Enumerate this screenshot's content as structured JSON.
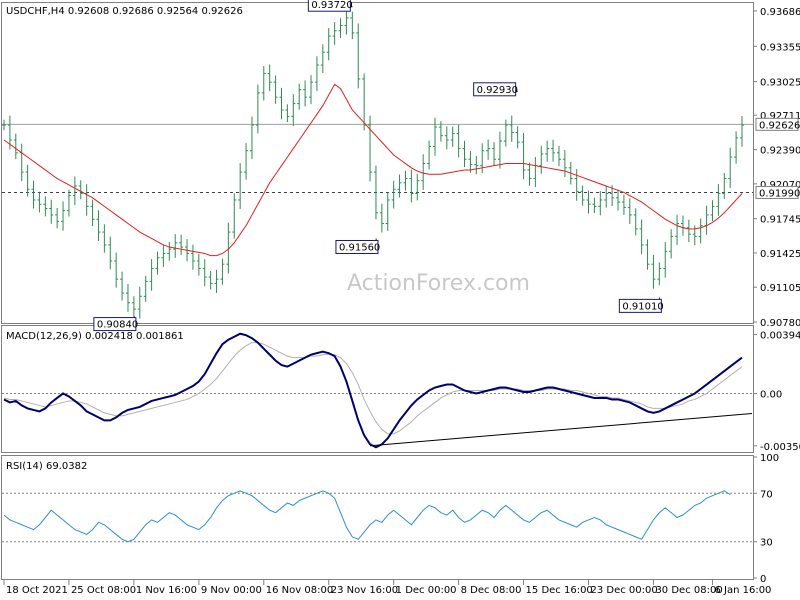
{
  "colors": {
    "price_bars": "#2e8b57",
    "ma_line": "#e02020",
    "macd_main": "#00006e",
    "macd_signal": "#b0b0b0",
    "rsi_line": "#2a8fd6",
    "grid": "#808080",
    "label_border": "#1a1a6e"
  },
  "chart_data": [
    {
      "type": "line",
      "panel": "price",
      "title": "USDCHF,H4 0.92608 0.92686 0.92564 0.92626",
      "y_ticks": [
        "0.93686",
        "0.93355",
        "0.93025",
        "0.92711",
        "0.92390",
        "0.92070",
        "0.91745",
        "0.91425",
        "0.91105",
        "0.90780"
      ],
      "y_tick_values": [
        0.93686,
        0.93355,
        0.93025,
        0.92711,
        0.9239,
        0.9207,
        0.91745,
        0.91425,
        0.91105,
        0.9078
      ],
      "ylim": [
        0.9078,
        0.9375
      ],
      "current_price_label": "0.92626",
      "current_price": 0.92626,
      "support_label": "0.91990",
      "support_level": 0.9199,
      "annotations": [
        {
          "text": "0.93720",
          "value": 0.9372,
          "bar": 59
        },
        {
          "text": "0.92930",
          "value": 0.9293,
          "bar": 87
        },
        {
          "text": "0.91560",
          "value": 0.9156,
          "bar": 63
        },
        {
          "text": "0.90840",
          "value": 0.9084,
          "bar": 22
        },
        {
          "text": "0.91010",
          "value": 0.9101,
          "bar": 111
        }
      ],
      "close": [
        0.9262,
        0.9248,
        0.9236,
        0.9218,
        0.9202,
        0.9192,
        0.9188,
        0.9184,
        0.9178,
        0.9172,
        0.9182,
        0.9196,
        0.9205,
        0.9198,
        0.9186,
        0.9174,
        0.9162,
        0.915,
        0.9135,
        0.9118,
        0.9105,
        0.9096,
        0.909,
        0.9102,
        0.9116,
        0.9128,
        0.9138,
        0.9142,
        0.9146,
        0.9152,
        0.9148,
        0.9142,
        0.9135,
        0.9128,
        0.912,
        0.9114,
        0.9118,
        0.9132,
        0.9162,
        0.9192,
        0.9218,
        0.9238,
        0.9262,
        0.9292,
        0.931,
        0.9302,
        0.9288,
        0.9276,
        0.927,
        0.9282,
        0.9295,
        0.9288,
        0.9302,
        0.9318,
        0.933,
        0.9345,
        0.935,
        0.9355,
        0.9362,
        0.9348,
        0.9305,
        0.9262,
        0.9218,
        0.918,
        0.917,
        0.9192,
        0.9202,
        0.9208,
        0.9212,
        0.9198,
        0.921,
        0.9226,
        0.9242,
        0.926,
        0.9252,
        0.9248,
        0.9254,
        0.924,
        0.923,
        0.9225,
        0.9224,
        0.9238,
        0.924,
        0.923,
        0.9247,
        0.9262,
        0.9255,
        0.9246,
        0.922,
        0.9212,
        0.9224,
        0.9235,
        0.924,
        0.9236,
        0.923,
        0.9222,
        0.9212,
        0.92,
        0.9192,
        0.9188,
        0.9186,
        0.9192,
        0.9198,
        0.9194,
        0.919,
        0.9185,
        0.9178,
        0.9165,
        0.915,
        0.9132,
        0.9118,
        0.9128,
        0.9144,
        0.9158,
        0.917,
        0.9166,
        0.916,
        0.9158,
        0.9168,
        0.9178,
        0.9186,
        0.9198,
        0.9212,
        0.9232,
        0.925,
        0.9262
      ],
      "ma": [
        0.9248,
        0.9244,
        0.924,
        0.9236,
        0.9232,
        0.9228,
        0.9224,
        0.922,
        0.9216,
        0.9212,
        0.9209,
        0.9206,
        0.9203,
        0.92,
        0.9197,
        0.9194,
        0.919,
        0.9186,
        0.9182,
        0.9178,
        0.9174,
        0.917,
        0.9166,
        0.9162,
        0.9159,
        0.9156,
        0.9153,
        0.915,
        0.9148,
        0.9147,
        0.9146,
        0.9145,
        0.9144,
        0.9143,
        0.9142,
        0.914,
        0.914,
        0.9142,
        0.9146,
        0.9152,
        0.916,
        0.9168,
        0.9178,
        0.9188,
        0.9198,
        0.9208,
        0.9216,
        0.9224,
        0.9232,
        0.924,
        0.9248,
        0.9256,
        0.9264,
        0.9272,
        0.928,
        0.929,
        0.93,
        0.9296,
        0.9286,
        0.9276,
        0.927,
        0.9264,
        0.9258,
        0.9252,
        0.9246,
        0.924,
        0.9234,
        0.923,
        0.9226,
        0.9222,
        0.9219,
        0.9217,
        0.9216,
        0.9216,
        0.9216,
        0.9217,
        0.9218,
        0.9219,
        0.922,
        0.922,
        0.9221,
        0.9222,
        0.9223,
        0.9224,
        0.9225,
        0.9226,
        0.9226,
        0.9226,
        0.9226,
        0.9225,
        0.9224,
        0.9223,
        0.9222,
        0.9221,
        0.922,
        0.9219,
        0.9217,
        0.9215,
        0.9213,
        0.9211,
        0.9209,
        0.9207,
        0.9205,
        0.9203,
        0.9201,
        0.9199,
        0.9196,
        0.9193,
        0.919,
        0.9186,
        0.9182,
        0.9178,
        0.9174,
        0.9171,
        0.9168,
        0.9166,
        0.9165,
        0.9165,
        0.9166,
        0.9168,
        0.9171,
        0.9175,
        0.918,
        0.9186,
        0.9192,
        0.9198
      ]
    },
    {
      "type": "line",
      "panel": "macd",
      "title": "MACD(12,26,9) 0.002418 0.001861",
      "y_ticks": [
        "0.003944",
        "0.00",
        "-0.003506"
      ],
      "y_tick_values": [
        0.003944,
        0.0,
        -0.003506
      ],
      "ylim": [
        -0.00385,
        0.00445
      ],
      "series": [
        {
          "values": [
            -0.0004,
            -0.0006,
            -0.0005,
            -0.0008,
            -0.001,
            -0.0011,
            -0.0012,
            -0.001,
            -0.0006,
            -0.0003,
            0.0,
            -0.0002,
            -0.0005,
            -0.0008,
            -0.0012,
            -0.0014,
            -0.0016,
            -0.0018,
            -0.0018,
            -0.0016,
            -0.0013,
            -0.0011,
            -0.001,
            -0.0009,
            -0.0007,
            -0.0005,
            -0.0004,
            -0.0003,
            -0.0002,
            -0.0001,
            0.0001,
            0.0003,
            0.0005,
            0.0008,
            0.0013,
            0.002,
            0.0027,
            0.0033,
            0.0036,
            0.0038,
            0.004,
            0.0039,
            0.0037,
            0.0034,
            0.003,
            0.0026,
            0.0022,
            0.0019,
            0.0018,
            0.002,
            0.0022,
            0.0024,
            0.0026,
            0.0027,
            0.0028,
            0.0027,
            0.0025,
            0.0018,
            0.0008,
            -0.0005,
            -0.0018,
            -0.0028,
            -0.0034,
            -0.0036,
            -0.0034,
            -0.003,
            -0.0024,
            -0.0018,
            -0.0013,
            -0.0008,
            -0.0004,
            -0.0001,
            0.0002,
            0.0004,
            0.0005,
            0.0006,
            0.0006,
            0.0004,
            0.0002,
            0.0001,
            0.0,
            0.0001,
            0.0002,
            0.0003,
            0.0004,
            0.0004,
            0.0003,
            0.0002,
            0.0001,
            0.0001,
            0.0002,
            0.0003,
            0.0004,
            0.0004,
            0.0003,
            0.0002,
            0.0001,
            0.0,
            -0.0001,
            -0.0002,
            -0.0003,
            -0.0003,
            -0.0003,
            -0.0004,
            -0.0004,
            -0.0005,
            -0.0006,
            -0.0008,
            -0.001,
            -0.0012,
            -0.0013,
            -0.0012,
            -0.001,
            -0.0008,
            -0.0006,
            -0.0004,
            -0.0002,
            0.0,
            0.0003,
            0.0006,
            0.0009,
            0.0012,
            0.0015,
            0.0018,
            0.0021,
            0.0024
          ]
        },
        {
          "values": [
            -0.0003,
            -0.0004,
            -0.0004,
            -0.0005,
            -0.0006,
            -0.0007,
            -0.0008,
            -0.0009,
            -0.0008,
            -0.0007,
            -0.0006,
            -0.0005,
            -0.0005,
            -0.0006,
            -0.0007,
            -0.0009,
            -0.0011,
            -0.0013,
            -0.0014,
            -0.0015,
            -0.0015,
            -0.0014,
            -0.0013,
            -0.0012,
            -0.0011,
            -0.001,
            -0.0009,
            -0.0008,
            -0.0007,
            -0.0006,
            -0.0005,
            -0.0004,
            -0.0002,
            0.0,
            0.0003,
            0.0006,
            0.001,
            0.0015,
            0.002,
            0.0025,
            0.0029,
            0.0032,
            0.0034,
            0.0034,
            0.0033,
            0.0031,
            0.0029,
            0.0027,
            0.0025,
            0.0024,
            0.0024,
            0.0024,
            0.0025,
            0.0025,
            0.0026,
            0.0026,
            0.0026,
            0.0024,
            0.002,
            0.0014,
            0.0006,
            -0.0004,
            -0.0012,
            -0.0019,
            -0.0024,
            -0.0027,
            -0.0027,
            -0.0025,
            -0.0022,
            -0.0019,
            -0.0015,
            -0.0012,
            -0.0009,
            -0.0006,
            -0.0003,
            -0.0001,
            0.0001,
            0.0002,
            0.0002,
            0.0002,
            0.0002,
            0.0002,
            0.0002,
            0.0002,
            0.0003,
            0.0003,
            0.0003,
            0.0003,
            0.0002,
            0.0002,
            0.0002,
            0.0002,
            0.0003,
            0.0003,
            0.0003,
            0.0003,
            0.0002,
            0.0002,
            0.0001,
            0.0,
            -0.0001,
            -0.0002,
            -0.0002,
            -0.0003,
            -0.0003,
            -0.0004,
            -0.0005,
            -0.0006,
            -0.0007,
            -0.0009,
            -0.001,
            -0.001,
            -0.001,
            -0.0009,
            -0.0008,
            -0.0007,
            -0.0005,
            -0.0004,
            -0.0002,
            0.0,
            0.0003,
            0.0006,
            0.0009,
            0.0012,
            0.0015,
            0.0018
          ]
        }
      ],
      "trendline": [
        [
          62,
          -0.0035
        ],
        [
          125,
          -0.0014
        ]
      ]
    },
    {
      "type": "line",
      "panel": "rsi",
      "title": "RSI(14) 69.0382",
      "y_ticks": [
        "100",
        "70",
        "30",
        "0"
      ],
      "y_tick_values": [
        100,
        70,
        30,
        0
      ],
      "ylim": [
        0,
        100
      ],
      "levels": [
        70,
        30
      ],
      "series": [
        {
          "values": [
            52,
            48,
            46,
            44,
            42,
            40,
            44,
            50,
            56,
            52,
            48,
            44,
            40,
            38,
            36,
            40,
            46,
            44,
            40,
            36,
            32,
            30,
            32,
            38,
            44,
            48,
            46,
            50,
            54,
            52,
            48,
            44,
            42,
            40,
            44,
            50,
            58,
            64,
            68,
            70,
            72,
            70,
            68,
            64,
            60,
            56,
            54,
            58,
            62,
            60,
            64,
            66,
            68,
            70,
            72,
            70,
            66,
            54,
            42,
            34,
            32,
            38,
            44,
            48,
            46,
            52,
            56,
            52,
            48,
            44,
            50,
            56,
            60,
            58,
            54,
            52,
            56,
            50,
            46,
            48,
            52,
            56,
            54,
            50,
            56,
            60,
            56,
            52,
            48,
            46,
            50,
            54,
            56,
            52,
            48,
            46,
            44,
            42,
            46,
            48,
            50,
            48,
            44,
            42,
            40,
            38,
            36,
            34,
            32,
            40,
            48,
            54,
            58,
            54,
            50,
            52,
            56,
            60,
            62,
            66,
            68,
            70,
            72,
            69
          ]
        }
      ]
    }
  ],
  "x_axis_labels": [
    "18 Oct 2021",
    "25 Oct 08:00",
    "1 Nov 16:00",
    "9 Nov 00:00",
    "16 Nov 08:00",
    "23 Nov 16:00",
    "1 Dec 00:00",
    "8 Dec 08:00",
    "15 Dec 16:00",
    "23 Dec 00:00",
    "30 Dec 08:00",
    "6 Jan 16:00"
  ],
  "x_axis_label_bars": [
    0,
    11,
    22,
    33,
    44,
    55,
    66,
    77,
    88,
    99,
    110,
    120
  ],
  "watermark": "ActionForex.com"
}
